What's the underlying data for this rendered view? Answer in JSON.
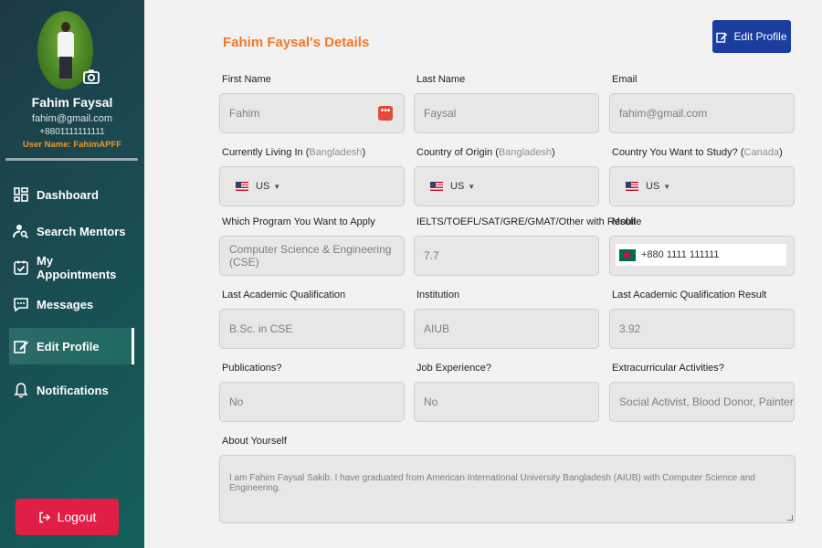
{
  "sidebar": {
    "name": "Fahim Faysal",
    "email": "fahim@gmail.com",
    "phone": "+8801111111111",
    "username": "User Name: FahimAPFF",
    "nav": [
      {
        "label": "Dashboard",
        "icon": "dashboard-icon"
      },
      {
        "label": "Search Mentors",
        "icon": "search-user-icon"
      },
      {
        "label": "My Appointments",
        "icon": "calendar-check-icon"
      },
      {
        "label": "Messages",
        "icon": "chat-icon"
      },
      {
        "label": "Edit Profile",
        "icon": "edit-icon",
        "active": true
      },
      {
        "label": "Notifications",
        "icon": "bell-icon"
      }
    ],
    "logout_label": "Logout"
  },
  "main": {
    "title": "Fahim Faysal's Details",
    "edit_button": "Edit Profile",
    "fields": {
      "first_name": {
        "label": "First Name",
        "value": "Fahim"
      },
      "last_name": {
        "label": "Last Name",
        "value": "Faysal"
      },
      "email": {
        "label": "Email",
        "value": "fahim@gmail.com"
      },
      "living_in": {
        "label": "Currently Living In (",
        "hint": "Bangladesh",
        "label_end": ")",
        "value": "US"
      },
      "origin": {
        "label": "Country of Origin (",
        "hint": "Bangladesh",
        "label_end": ")",
        "value": "US"
      },
      "study_country": {
        "label": "Country You Want to Study? (",
        "hint": "Canada",
        "label_end": ")",
        "value": "US"
      },
      "program": {
        "label": "Which Program You Want to Apply",
        "value": "Computer Science & Engineering (CSE)"
      },
      "test_result": {
        "label": "IELTS/TOEFL/SAT/GRE/GMAT/Other with Result",
        "value": "7.7"
      },
      "mobile": {
        "label": "Mobile",
        "value": "+880 1111 111111"
      },
      "qualification": {
        "label": "Last Academic Qualification",
        "value": "B.Sc. in CSE"
      },
      "institution": {
        "label": "Institution",
        "value": "AIUB"
      },
      "qual_result": {
        "label": "Last Academic Qualification Result",
        "value": "3.92"
      },
      "publications": {
        "label": "Publications?",
        "value": "No"
      },
      "job_experience": {
        "label": "Job Experience?",
        "value": "No"
      },
      "extracurricular": {
        "label": "Extracurricular Activities?",
        "value": "Social Activist, Blood Donor, Painter"
      },
      "about": {
        "label": "About Yourself",
        "value": "I am Fahim Faysal Sakib. I  have graduated from American International University Bangladesh (AIUB) with Computer Science and Engineering."
      }
    }
  },
  "colors": {
    "accent_orange": "#f07a2a",
    "edit_button": "#1b3da0",
    "logout_button": "#e11f46",
    "sidebar_start": "#1d3a44",
    "sidebar_end": "#15605a"
  }
}
